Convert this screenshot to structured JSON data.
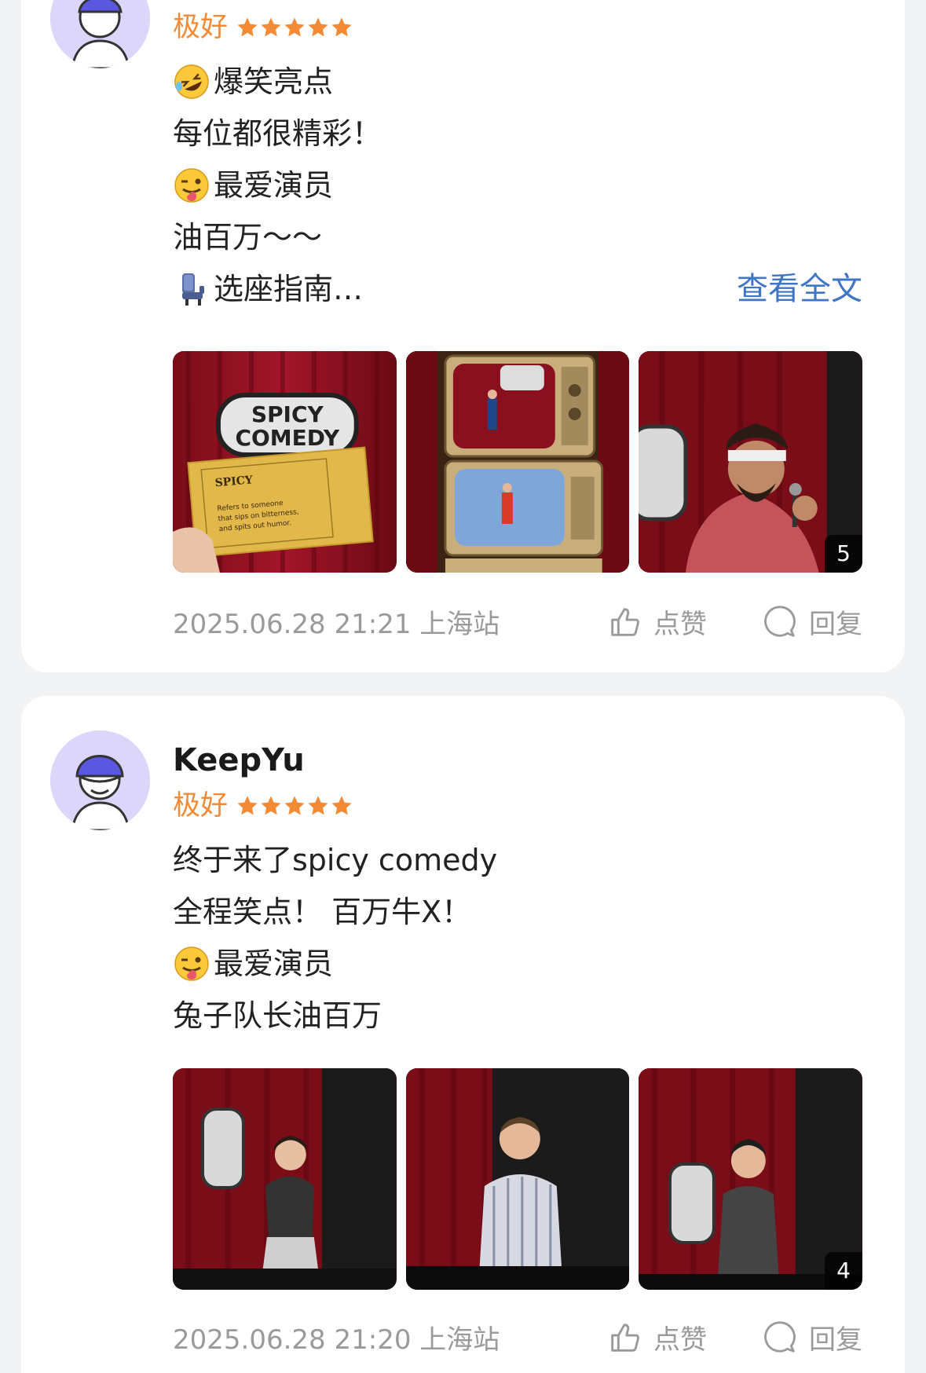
{
  "reviews": [
    {
      "username": "",
      "rating_word": "极好",
      "stars": 5,
      "lines": [
        {
          "emoji": "rofl-emoji",
          "text": "爆笑亮点"
        },
        {
          "emoji": "",
          "text": "每位都很精彩！"
        },
        {
          "emoji": "winking-tongue-emoji",
          "text": "最爱演员"
        },
        {
          "emoji": "",
          "text": "油百万～～"
        },
        {
          "emoji": "seat-emoji",
          "text": "选座指南…"
        }
      ],
      "read_more": "查看全文",
      "photo_count": "5",
      "timestamp": "2025.06.28 21:21 上海站",
      "like_label": "点赞",
      "reply_label": "回复"
    },
    {
      "username": "KeepYu",
      "rating_word": "极好",
      "stars": 5,
      "lines": [
        {
          "emoji": "",
          "text": "终于来了spicy comedy"
        },
        {
          "emoji": "",
          "text": "全程笑点！ 百万牛X！"
        },
        {
          "emoji": "winking-tongue-emoji",
          "text": "最爱演员"
        },
        {
          "emoji": "",
          "text": "兔子队长油百万"
        }
      ],
      "photo_count": "4",
      "timestamp": "2025.06.28 21:20 上海站",
      "like_label": "点赞",
      "reply_label": "回复"
    }
  ],
  "photo_text": {
    "sign": "SPICY COMEDY",
    "ticket_title": "SPICY",
    "ticket_body": "Refers to someone that sips on bitterness, and spits out humor."
  },
  "colors": {
    "accent_orange": "#f28a36",
    "link_blue": "#3f74c7",
    "meta_gray": "#9a9a9a",
    "card_bg": "#ffffff",
    "page_bg": "#f2f3f5"
  }
}
